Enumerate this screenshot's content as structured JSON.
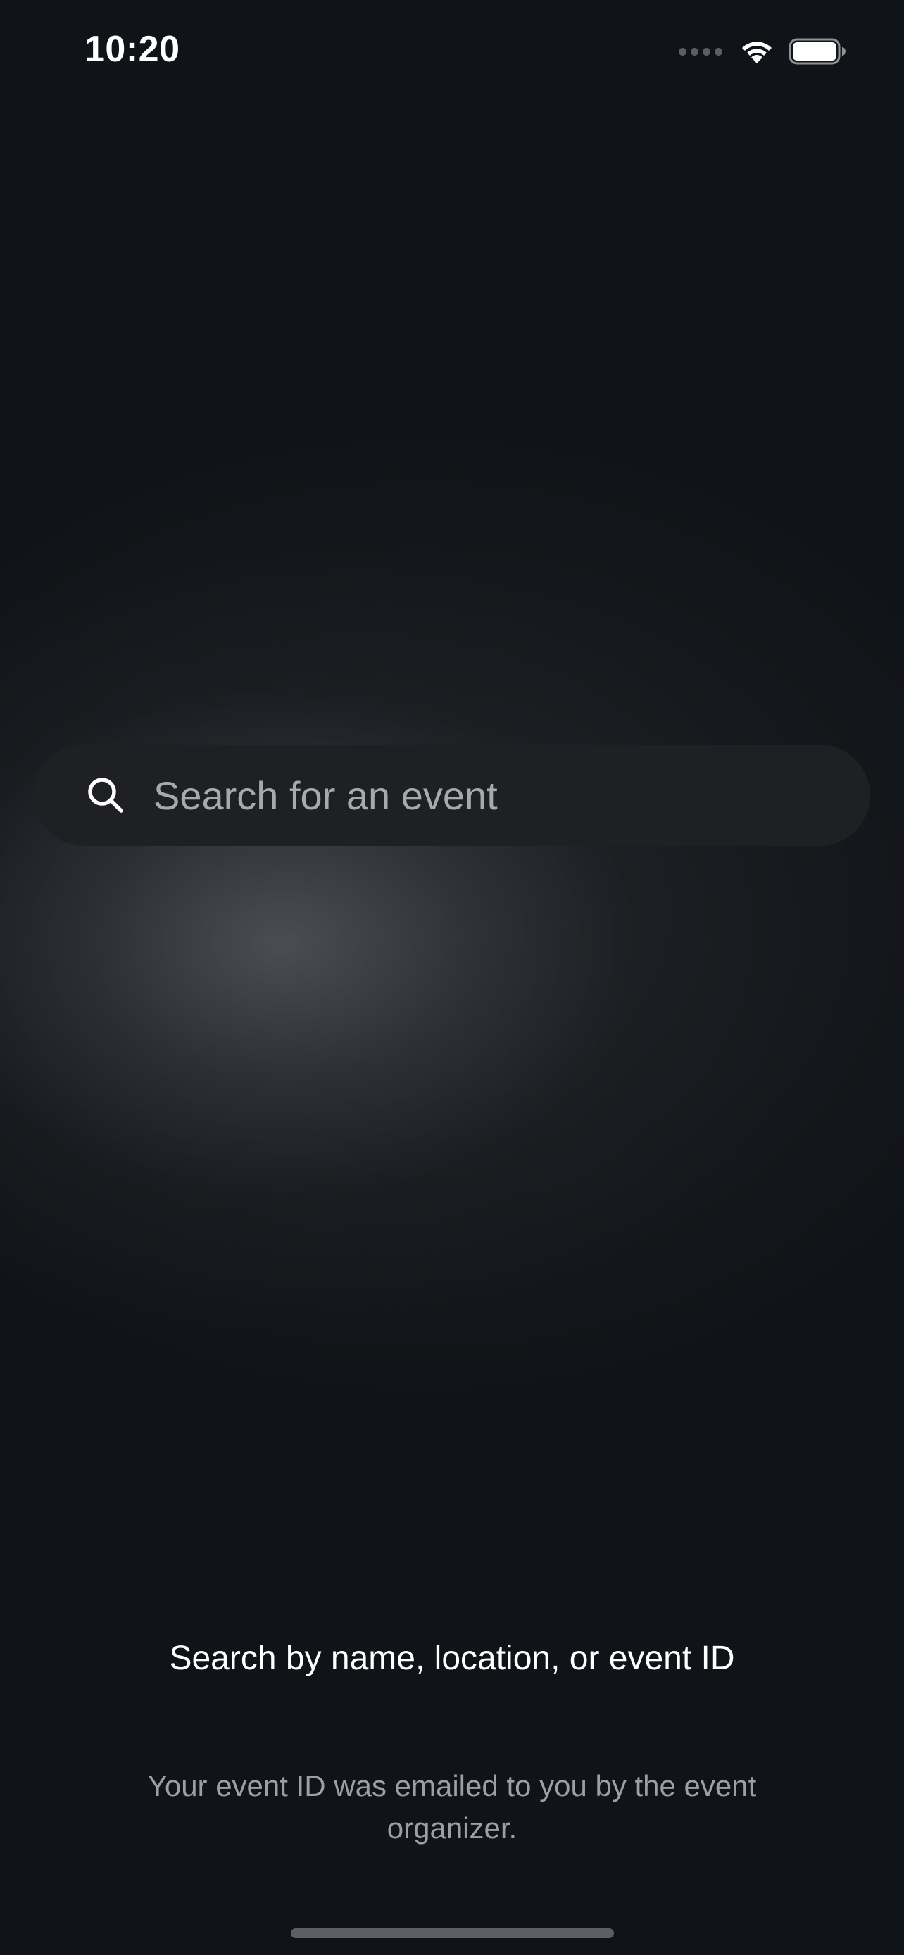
{
  "status_bar": {
    "time": "10:20",
    "icons": [
      "cellular-signal-icon",
      "wifi-icon",
      "battery-icon"
    ]
  },
  "search": {
    "placeholder": "Search for an event",
    "value": "",
    "icon": "search-icon"
  },
  "hint": {
    "title": "Search by name, location, or event ID",
    "subtitle": "Your event ID was emailed to you by the event organizer."
  },
  "colors": {
    "background": "#101317",
    "search_bar": "#1f2023",
    "primary_text": "#ffffff",
    "secondary_text": "#9c9fa4",
    "placeholder_text": "#a7a9ad"
  }
}
